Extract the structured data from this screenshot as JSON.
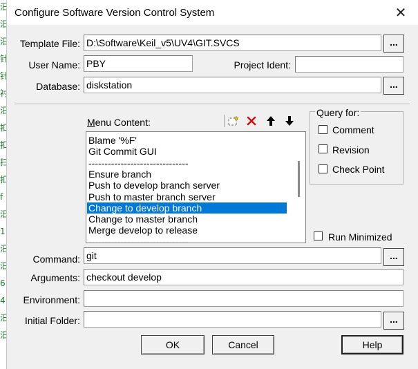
{
  "window": {
    "title": "Configure Software Version Control System"
  },
  "background_glyphs": [
    "汨",
    "汨",
    "汨",
    "针",
    "针",
    "衬",
    "汨",
    "扣",
    "扣",
    "扫",
    "扣",
    "f",
    "汨",
    "1",
    "汨",
    "汨",
    "6",
    "4",
    "汨",
    "汨"
  ],
  "fields": {
    "template_file": {
      "label": "Template File:",
      "value": "D:\\Software\\Keil_v5\\UV4\\GIT.SVCS",
      "browse": "..."
    },
    "user_name": {
      "label": "User Name:",
      "value": "PBY"
    },
    "project_ident": {
      "label": "Project Ident:",
      "value": ""
    },
    "database": {
      "label": "Database:",
      "value": "diskstation",
      "browse": "..."
    },
    "command": {
      "label": "Command:",
      "value": "git",
      "browse": "..."
    },
    "arguments": {
      "label": "Arguments:",
      "value": "checkout develop"
    },
    "environment": {
      "label": "Environment:",
      "value": ""
    },
    "initial_folder": {
      "label": "Initial Folder:",
      "value": "",
      "browse": "..."
    }
  },
  "menu": {
    "label_accel": "M",
    "label_rest": "enu Content:",
    "items": [
      "Blame '%F'",
      "Git Commit GUI",
      "-------------------------------",
      "Ensure branch",
      "Push to develop branch server",
      "Push to master branch server",
      "Change to develop branch",
      "Change to master branch",
      "Merge develop to release",
      "-------------------------------"
    ],
    "selected_index": 6,
    "toolbar_icons": [
      "new-item-icon",
      "delete-icon",
      "move-up-icon",
      "move-down-icon"
    ]
  },
  "query_for": {
    "title": "Query for:",
    "options": [
      {
        "label": "Comment",
        "checked": false
      },
      {
        "label": "Revision",
        "checked": false
      },
      {
        "label": "Check Point",
        "checked": false
      }
    ]
  },
  "run_minimized": {
    "label": "Run Minimized",
    "checked": false
  },
  "buttons": {
    "ok": "OK",
    "cancel": "Cancel",
    "help": "Help"
  },
  "colors": {
    "selection": "#0078d7",
    "delete_icon": "#d11010"
  }
}
